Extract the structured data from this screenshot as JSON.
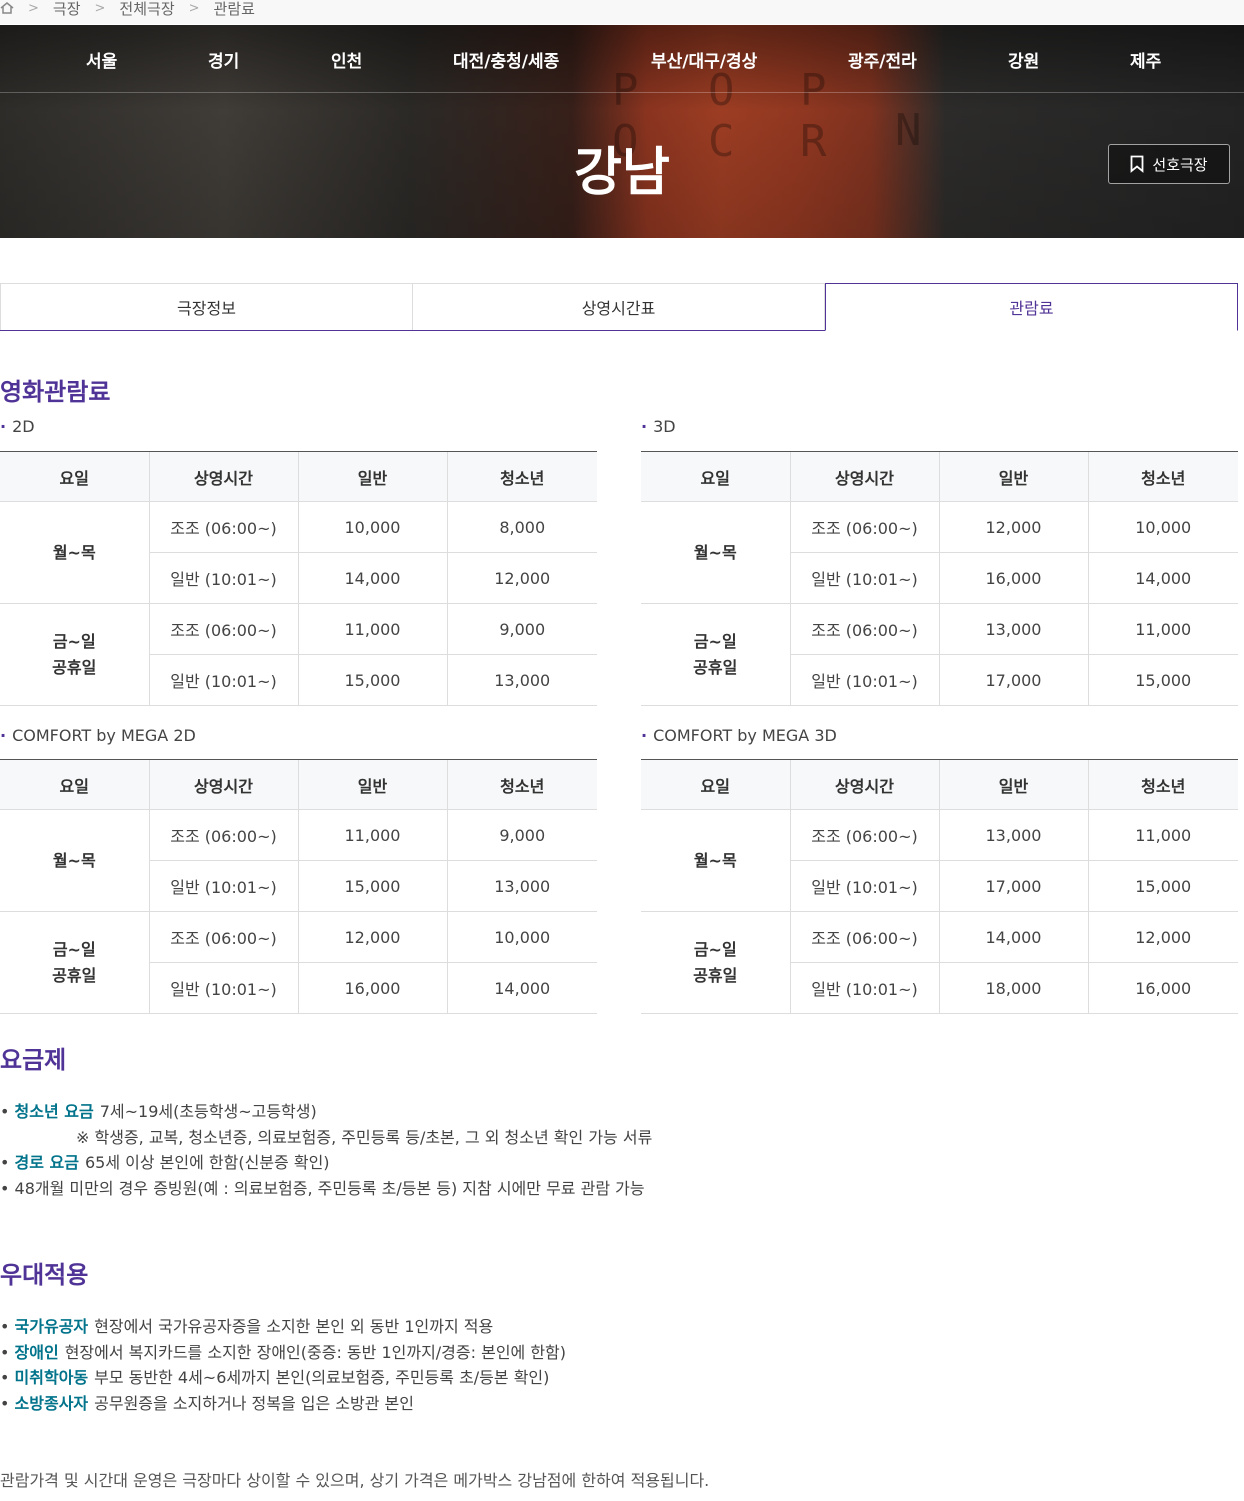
{
  "breadcrumb": [
    "극장",
    "전체극장",
    "관람료"
  ],
  "nav": [
    "서울",
    "경기",
    "인천",
    "대전/충청/세종",
    "부산/대구/경상",
    "광주/전라",
    "강원",
    "제주"
  ],
  "theater_name": "강남",
  "favorite_label": "선호극장",
  "tabs": [
    {
      "label": "극장정보",
      "active": false
    },
    {
      "label": "상영시간표",
      "active": false
    },
    {
      "label": "관람료",
      "active": true
    }
  ],
  "section_fee_title": "영화관람료",
  "price_header": {
    "day": "요일",
    "time": "상영시간",
    "adult": "일반",
    "youth": "청소년"
  },
  "day_groups": {
    "weekday": "월~목",
    "weekend_1": "금~일",
    "weekend_2": "공휴일"
  },
  "time_slots": {
    "early": "조조 (06:00~)",
    "normal": "일반 (10:01~)"
  },
  "price_tables": [
    {
      "label": "2D",
      "rows": [
        {
          "adult": "10,000",
          "youth": "8,000"
        },
        {
          "adult": "14,000",
          "youth": "12,000"
        },
        {
          "adult": "11,000",
          "youth": "9,000"
        },
        {
          "adult": "15,000",
          "youth": "13,000"
        }
      ]
    },
    {
      "label": "3D",
      "rows": [
        {
          "adult": "12,000",
          "youth": "10,000"
        },
        {
          "adult": "16,000",
          "youth": "14,000"
        },
        {
          "adult": "13,000",
          "youth": "11,000"
        },
        {
          "adult": "17,000",
          "youth": "15,000"
        }
      ]
    },
    {
      "label": "COMFORT by MEGA 2D",
      "rows": [
        {
          "adult": "11,000",
          "youth": "9,000"
        },
        {
          "adult": "15,000",
          "youth": "13,000"
        },
        {
          "adult": "12,000",
          "youth": "10,000"
        },
        {
          "adult": "16,000",
          "youth": "14,000"
        }
      ]
    },
    {
      "label": "COMFORT by MEGA 3D",
      "rows": [
        {
          "adult": "13,000",
          "youth": "11,000"
        },
        {
          "adult": "17,000",
          "youth": "15,000"
        },
        {
          "adult": "14,000",
          "youth": "12,000"
        },
        {
          "adult": "18,000",
          "youth": "16,000"
        }
      ]
    }
  ],
  "rate_plan": {
    "title": "요금제",
    "items": [
      {
        "label": "청소년 요금",
        "text": "7세~19세(초등학생~고등학생)"
      },
      {
        "note": "※ 학생증, 교복, 청소년증, 의료보험증, 주민등록 등/초본, 그 외 청소년 확인 가능 서류"
      },
      {
        "label": "경로 요금",
        "text": "65세 이상 본인에 한함(신분증 확인)"
      },
      {
        "label": "",
        "text": "48개월 미만의 경우 증빙원(예 : 의료보험증, 주민등록 초/등본 등) 지참 시에만 무료 관람 가능"
      }
    ]
  },
  "discount": {
    "title": "우대적용",
    "items": [
      {
        "label": "국가유공자",
        "text": "현장에서 국가유공자증을 소지한 본인 외 동반 1인까지 적용"
      },
      {
        "label": "장애인",
        "text": "현장에서 복지카드를 소지한 장애인(중증: 동반 1인까지/경증: 본인에 한함)"
      },
      {
        "label": "미취학아동",
        "text": "부모 동반한 4세~6세까지 본인(의료보험증, 주민등록 초/등본 확인)"
      },
      {
        "label": "소방종사자",
        "text": "공무원증을 소지하거나 정복을 입은 소방관 본인"
      }
    ]
  },
  "footnote": "관람가격 및 시간대 운영은 극장마다 상이할 수 있으며, 상기 가격은 메가박스 강남점에 한하여 적용됩니다.",
  "colors": {
    "brand": "#503396",
    "highlight": "#01738b"
  }
}
